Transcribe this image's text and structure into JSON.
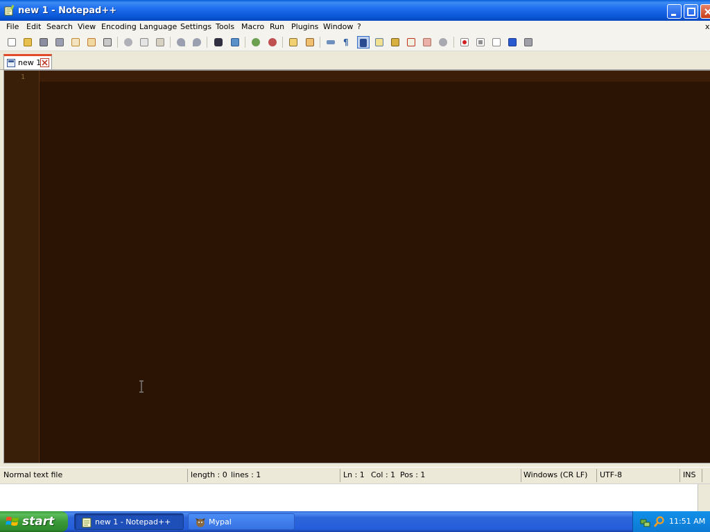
{
  "window": {
    "title": "new 1 - Notepad++"
  },
  "menu": {
    "items": [
      "File",
      "Edit",
      "Search",
      "View",
      "Encoding",
      "Language",
      "Settings",
      "Tools",
      "Macro",
      "Run",
      "Plugins",
      "Window",
      "?"
    ],
    "close_glyph": "x"
  },
  "toolbar": {
    "icons": [
      "new-file-icon",
      "open-file-icon",
      "save-icon",
      "save-all-icon",
      "close-icon",
      "close-all-icon",
      "print-icon",
      "cut-icon",
      "copy-icon",
      "paste-icon",
      "undo-icon",
      "redo-icon",
      "find-icon",
      "replace-icon",
      "zoom-in-icon",
      "zoom-out-icon",
      "sync-vertical-icon",
      "sync-horizontal-icon",
      "word-wrap-icon",
      "show-all-chars-icon",
      "indent-guide-icon",
      "doc-map-icon",
      "function-list-icon",
      "folder-workspace-icon",
      "doc-switcher-icon",
      "monitoring-icon",
      "record-macro-icon",
      "stop-record-icon",
      "play-macro-icon",
      "run-macro-multiple-icon",
      "save-macro-icon"
    ],
    "active_icon": "indent-guide-icon"
  },
  "tabs": [
    {
      "label": "new 1"
    }
  ],
  "editor": {
    "line_number": "1",
    "background": "#2c1404",
    "gutter_background": "#3a1f08"
  },
  "statusbar": {
    "file_type": "Normal text file",
    "length": "length : 0",
    "lines": "lines : 1",
    "ln": "Ln : 1",
    "col": "Col : 1",
    "pos": "Pos : 1",
    "eol": "Windows (CR LF)",
    "encoding": "UTF-8",
    "mode": "INS"
  },
  "taskbar": {
    "start_label": "start",
    "tasks": [
      {
        "label": "new 1 - Notepad++",
        "active": true
      },
      {
        "label": "Mypal",
        "active": false
      }
    ],
    "clock": "11:51 AM"
  },
  "colors": {
    "titlebar": "#0a58d6",
    "tab_accent": "#e24a2a",
    "start_green": "#3a9a38"
  }
}
